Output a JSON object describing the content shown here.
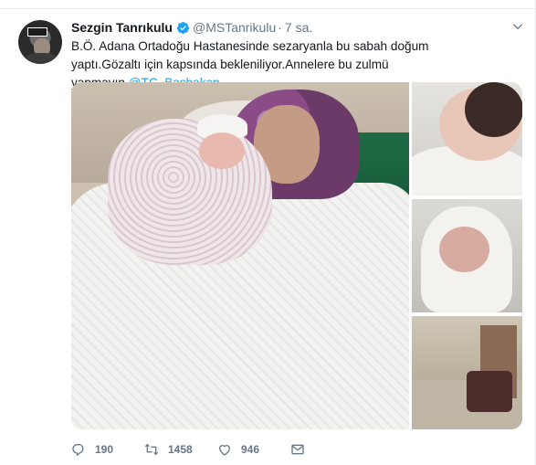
{
  "tweet": {
    "author_name": "Sezgin Tanrıkulu",
    "handle": "@MSTanrikulu",
    "separator": "·",
    "time": "7 sa.",
    "text_part1": "B.Ö. Adana Ortadoğu Hastanesinde sezaryanla bu sabah doğum yaptı.Gözaltı için kapsında bekleniliyor.Annelere bu zulmü yapmayın.",
    "mention": "@TC_Basbakan",
    "avatar_plate_text": "SAVAŞA HAYIR"
  },
  "actions": {
    "replies": "190",
    "retweets": "1458",
    "likes": "946"
  },
  "icons": {
    "verified": "verified-badge-icon",
    "chevron": "chevron-down-icon",
    "reply": "reply-icon",
    "retweet": "retweet-icon",
    "like": "heart-icon",
    "message": "envelope-icon"
  },
  "colors": {
    "link": "#1da1f2",
    "muted": "#657786",
    "text": "#14171a"
  }
}
